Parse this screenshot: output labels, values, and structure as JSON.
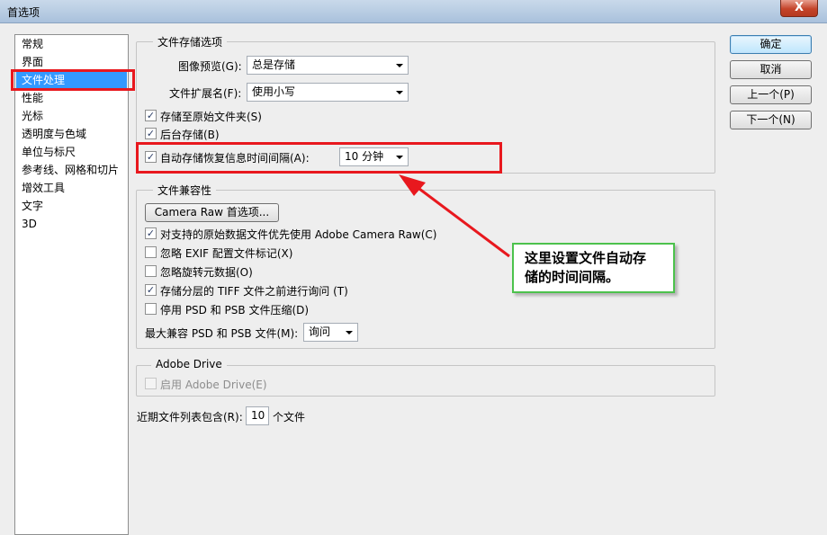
{
  "window": {
    "title": "首选项",
    "close_glyph": "X"
  },
  "sidebar": {
    "items": [
      {
        "label": "常规"
      },
      {
        "label": "界面"
      },
      {
        "label": "文件处理"
      },
      {
        "label": "性能"
      },
      {
        "label": "光标"
      },
      {
        "label": "透明度与色域"
      },
      {
        "label": "单位与标尺"
      },
      {
        "label": "参考线、网格和切片"
      },
      {
        "label": "增效工具"
      },
      {
        "label": "文字"
      },
      {
        "label": "3D"
      }
    ],
    "selected": "文件处理"
  },
  "file_save": {
    "legend": "文件存储选项",
    "image_preview_label": "图像预览(G):",
    "image_preview_value": "总是存储",
    "extension_label": "文件扩展名(F):",
    "extension_value": "使用小写",
    "save_to_original_folder": {
      "label": "存储至原始文件夹(S)",
      "checked": true
    },
    "background_save": {
      "label": "后台存储(B)",
      "checked": true
    },
    "auto_save": {
      "label": "自动存储恢复信息时间间隔(A):",
      "checked": true
    },
    "auto_save_interval": "10 分钟"
  },
  "compat": {
    "legend": "文件兼容性",
    "camera_raw_button": "Camera Raw 首选项...",
    "prefer_acr": {
      "label": "对支持的原始数据文件优先使用 Adobe Camera Raw(C)",
      "checked": true
    },
    "ignore_exif": {
      "label": "忽略 EXIF 配置文件标记(X)",
      "checked": false
    },
    "ignore_rotation": {
      "label": "忽略旋转元数据(O)",
      "checked": false
    },
    "ask_tiff": {
      "label": "存储分层的 TIFF 文件之前进行询问 (T)",
      "checked": true
    },
    "disable_psd_compress": {
      "label": "停用 PSD 和 PSB 文件压缩(D)",
      "checked": false
    },
    "max_compat_label": "最大兼容 PSD 和 PSB 文件(M):",
    "max_compat_value": "询问"
  },
  "adobe_drive": {
    "legend": "Adobe Drive",
    "enable": {
      "label": "启用 Adobe Drive(E)",
      "checked": false,
      "disabled": true
    }
  },
  "recent": {
    "label_before": "近期文件列表包含(R):",
    "value": "10",
    "label_after": "个文件"
  },
  "buttons": {
    "ok": "确定",
    "cancel": "取消",
    "prev": "上一个(P)",
    "next": "下一个(N)"
  },
  "callout": {
    "line1": "这里设置文件自动存",
    "line2": "储的时间间隔。"
  },
  "icons": {
    "checkmark": "✓"
  },
  "colors": {
    "highlight_red": "#e8181e",
    "callout_border": "#4cc24c",
    "selection_blue": "#3399ff"
  }
}
